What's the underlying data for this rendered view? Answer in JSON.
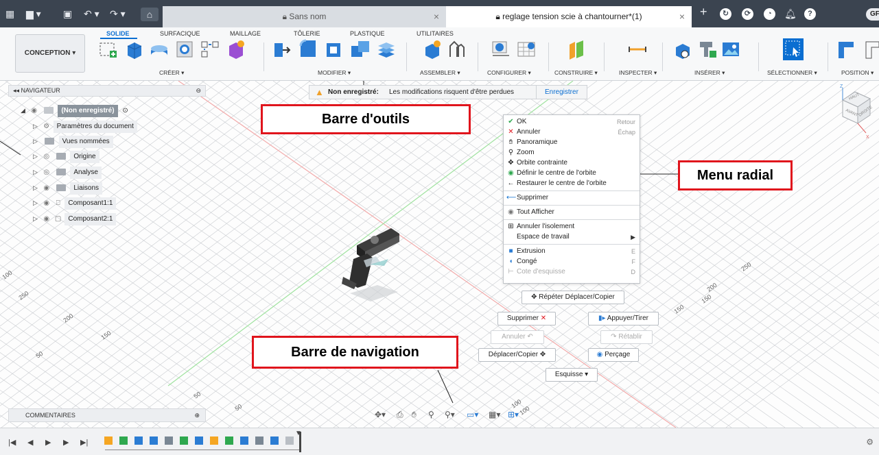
{
  "titlebar": {
    "doc_tab_1": "Sans nom",
    "doc_tab_2": "reglage tension scie à chantourner*(1)",
    "avatar": "GF"
  },
  "toolbar": {
    "workspace": "CONCEPTION ▾",
    "tabs": [
      "SOLIDE",
      "SURFACIQUE",
      "MAILLAGE",
      "TÔLERIE",
      "PLASTIQUE",
      "UTILITAIRES"
    ],
    "groups": [
      "CRÉER ▾",
      "MODIFIER ▾",
      "ASSEMBLER ▾",
      "CONFIGURER ▾",
      "CONSTRUIRE ▾",
      "INSPECTER ▾",
      "INSÉRER ▾",
      "SÉLECTIONNER ▾",
      "POSITION ▾"
    ]
  },
  "navigator": {
    "title": "NAVIGATEUR",
    "root": "(Non enregistré)",
    "items": [
      "Paramètres du document",
      "Vues nommées",
      "Origine",
      "Analyse",
      "Liaisons",
      "Composant1:1",
      "Composant2:1"
    ]
  },
  "warning": {
    "title": "Non enregistré:",
    "message": "Les modifications risquent d'être perdues",
    "action": "Enregistrer"
  },
  "radial_menu": {
    "items": [
      {
        "label": "OK",
        "shortcut": "Retour"
      },
      {
        "label": "Annuler",
        "shortcut": "Échap"
      },
      {
        "label": "Panoramique",
        "shortcut": ""
      },
      {
        "label": "Zoom",
        "shortcut": ""
      },
      {
        "label": "Orbite contrainte",
        "shortcut": ""
      },
      {
        "label": "Définir le centre de l'orbite",
        "shortcut": ""
      },
      {
        "label": "Restaurer le centre de l'orbite",
        "shortcut": ""
      },
      {
        "label": "Supprimer",
        "shortcut": ""
      },
      {
        "label": "Tout Afficher",
        "shortcut": ""
      },
      {
        "label": "Annuler l'isolement",
        "shortcut": ""
      },
      {
        "label": "Espace de travail",
        "shortcut": ""
      },
      {
        "label": "Extrusion",
        "shortcut": "E"
      },
      {
        "label": "Congé",
        "shortcut": "F"
      },
      {
        "label": "Cote d'esquisse",
        "shortcut": "D"
      }
    ],
    "repeat": "Répéter Déplacer/Copier",
    "delete": "Supprimer",
    "presspull": "Appuyer/Tirer",
    "undo": "Annuler",
    "redo": "Rétablir",
    "move": "Déplacer/Copier",
    "hole": "Perçage",
    "sketch": "Esquisse ▾"
  },
  "annotations": {
    "toolbar": "Barre d'outils",
    "radial": "Menu radial",
    "navbar": "Barre de navigation"
  },
  "comments": "COMMENTAIRES",
  "viewcube": {
    "top": "HAUT",
    "front": "AVANT",
    "right": "DROITE",
    "axis_z": "Z",
    "axis_x": "X"
  },
  "grid_labels": [
    "250",
    "200",
    "150",
    "100",
    "50",
    "250",
    "200",
    "150",
    "100",
    "50",
    "50",
    "100",
    "150"
  ],
  "colors": {
    "accent": "#0a6ed1",
    "annotation_red": "#e0141c",
    "appbar": "#3b4450"
  }
}
